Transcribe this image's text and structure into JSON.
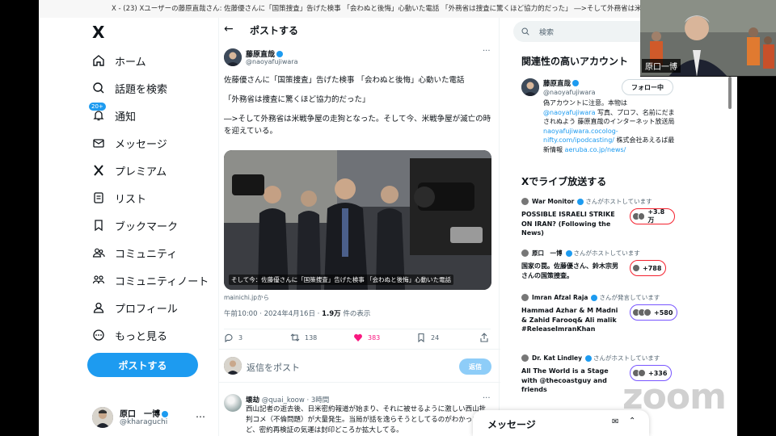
{
  "window": {
    "title": "X - (23) Xユーザーの藤原直哉さん: 佐藤優さんに「国策捜査」告げた検事 「会わぬと後悔」心動いた電話 「外務省は捜査に驚くほど協力的だった」 ―>そして外務省は米戦争屋の走狗となった。そして今、米戦争屋が滅亡の時を迎えている。"
  },
  "sidebar": {
    "logo": "X",
    "items": [
      {
        "label": "ホーム",
        "icon": "home-icon"
      },
      {
        "label": "話題を検索",
        "icon": "search-icon"
      },
      {
        "label": "通知",
        "icon": "bell-icon",
        "badge": "20+"
      },
      {
        "label": "メッセージ",
        "icon": "mail-icon"
      },
      {
        "label": "プレミアム",
        "icon": "x-premium-icon"
      },
      {
        "label": "リスト",
        "icon": "list-icon"
      },
      {
        "label": "ブックマーク",
        "icon": "bookmark-icon"
      },
      {
        "label": "コミュニティ",
        "icon": "community-icon"
      },
      {
        "label": "コミュニティノート",
        "icon": "community-notes-icon"
      },
      {
        "label": "プロフィール",
        "icon": "profile-icon"
      },
      {
        "label": "もっと見る",
        "icon": "more-circle-icon"
      }
    ],
    "post_button": "ポストする",
    "account": {
      "name": "原口　一博",
      "handle": "@kharaguchi",
      "more": "…"
    }
  },
  "main": {
    "header_title": "ポストする",
    "tweet": {
      "author_name": "藤原直哉",
      "author_handle": "@naoyafujiwara",
      "paragraphs": [
        "佐藤優さんに「国策捜査」告げた検事 「会わぬと後悔」心動いた電話",
        "「外務省は捜査に驚くほど協力的だった」",
        "―>そして外務省は米戦争屋の走狗となった。そして今、米戦争屋が滅亡の時を迎えている。"
      ],
      "media_caption": "そして今：佐藤優さんに「国策捜査」告げた検事 「会わぬと後悔」心動いた電話",
      "source": "mainichi.jpから",
      "time": "午前10:00 · 2024年4月16日 · ",
      "views": "1.9万",
      "views_suffix": " 件の表示",
      "counts": {
        "reply": "3",
        "retweet": "138",
        "like": "383",
        "bookmark": "24"
      }
    },
    "reply_box": {
      "placeholder": "返信をポスト",
      "button": "返信"
    },
    "reply": {
      "name": "壊劫",
      "handle": "@quai_koow",
      "time": "· 3時間",
      "text": "西山記者の逝去後、日米密約報道が始まり、それに被せるように激しい西山批判コメ（不倫問題）が大量発生。当局が話を逸らそうとしてるのがわかったけど、密約再検証の気運は封印どころか拡大してる。"
    }
  },
  "right": {
    "search_placeholder": "検索",
    "related_title": "関連性の高いアカウント",
    "account": {
      "name": "藤原直哉",
      "handle": "@naoyafujiwara",
      "follow_label": "フォロー中",
      "bio_1": "偽アカウントに注意。本物は ",
      "bio_link1": "@naoyafujiwara",
      "bio_2": " 写真、プロフ、名前にだまされぬよう 藤原直哉のインターネット放送局 ",
      "bio_link2": "naoyafujiwara.cocolog-nifty.com/ipodcasting/",
      "bio_3": " 株式会社あえるば最新情報 ",
      "bio_link3": "aeruba.co.jp/news/"
    },
    "live_title": "Xでライブ放送する",
    "live": [
      {
        "host": "War Monitor",
        "suffix": "さんがホストしています",
        "title": "POSSIBLE ISRAELI STRIKE ON IRAN? (Following the News)",
        "count": "+3.8万",
        "ring": "red"
      },
      {
        "host": "原口　一博",
        "suffix": "さんがホストしています",
        "title": "国家の罠。佐藤優さん、鈴木宗男さんの国策捜査。",
        "count": "+788",
        "ring": "red"
      },
      {
        "host": "Imran Afzal Raja",
        "suffix": "さんが発言しています",
        "title": "Hammad Azhar & M Madni & Zahid Farooq& Ali malik #ReleaseImranKhan",
        "count": "+580",
        "ring": "purple"
      },
      {
        "host": "Dr. Kat Lindley",
        "suffix": "さんがホストしています",
        "title": "All The World is a Stage with @thecoastguy and friends",
        "count": "+336",
        "ring": "purple"
      }
    ],
    "messages_label": "メッセージ"
  },
  "webcam": {
    "name_tag": "原口一博"
  },
  "watermark": "zoom"
}
